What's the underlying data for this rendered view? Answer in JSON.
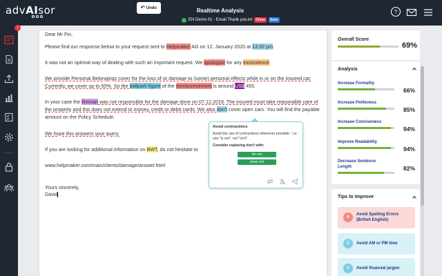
{
  "app": {
    "logo_light": "adv",
    "logo_bold": "AI",
    "logo_end": "sor",
    "title": "Realtime Analysis",
    "undo_label": "Undo",
    "doc_name": "EN Demo 01 - Email Thank you.txt",
    "close_tag": "Close",
    "save_tag": "Save",
    "sidebar_badge": "‹"
  },
  "document": {
    "greeting": "Dear Mr Fin,",
    "p1": {
      "a": "Please find our response below to your request sent to ",
      "b": "Helpmaker",
      "c": " AG on 12. January 2020 at ",
      "d": "13:32 pm",
      "e": "."
    },
    "p2": {
      "a": "It was not an optimal way of dealing with such an important request. We ",
      "b": "apologize",
      "c": " for any ",
      "d": "inconvience"
    },
    "p3": {
      "a": "We provide Personal Belongings cover for the loss of or damage to (some) personal effects while in or on the insured car. Currently, we cover up to 50%. So the ",
      "b": "ballpark figure",
      "c": " of the ",
      "d": "reimburesement",
      "e": " is around ",
      "f": "US$",
      "g": " 455."
    },
    "p4": {
      "a": "In your case the ",
      "b": "fireman",
      "c": " was not responsible for the damage done on 07.12.2019. The insured must take reasonable care of the property and this does not extend to money, credit or debit cards. We also ",
      "d": "don't",
      "e": " cover open cars. You will find the payable amount on the Policy Schedule."
    },
    "p5": "We hope this answers your query.",
    "p6": {
      "a": "If you are looking for additional information on ",
      "b": "BWT",
      "c": ", do not hesitate to"
    },
    "link": "www.helpmaker.com/main/clients/damage/answer.html",
    "closing": "Yours sincerely,",
    "signature": "David"
  },
  "popup": {
    "title": "Avoid contractions",
    "description": "Avoid the use of contractions whenever possible - i.e: use \"is not\", not \"isn't\".",
    "consider": "Consider replacing don't with:",
    "options": [
      "do not",
      "does not"
    ],
    "icons": [
      "hide-icon",
      "ignore-icon",
      "send-icon"
    ]
  },
  "score": {
    "label": "Overall Score",
    "value": "69%",
    "fraction": 0.69
  },
  "analysis": {
    "title": "Analysis",
    "metrics": [
      {
        "label": "Increase Formality",
        "value": "66%",
        "fraction": 0.66
      },
      {
        "label": "Increase Politeness",
        "value": "85%",
        "fraction": 0.85
      },
      {
        "label": "Increase Conciseness",
        "value": "94%",
        "fraction": 0.94
      },
      {
        "label": "Improve Readability",
        "value": "94%",
        "fraction": 0.94
      },
      {
        "label": "Decrease Sentence Length",
        "value": "82%",
        "fraction": 0.82
      }
    ]
  },
  "tips": {
    "title": "Tips to Improve",
    "items": [
      {
        "count": "4",
        "label": "Avoid Spelling Errors (British English)",
        "bg": "#fbd9d6",
        "circle": "#f08a84"
      },
      {
        "count": "1",
        "label": "Avoid AM or PM time",
        "bg": "#d7f1f6",
        "circle": "#7ccfe2"
      },
      {
        "count": "1",
        "label": "Avoid financial jargon",
        "bg": "#d7f1f6",
        "circle": "#7ccfe2"
      }
    ]
  },
  "colors": {
    "dark": "#1f2733",
    "accent_red": "#e0383e",
    "bar_green": "#6fb23a",
    "popup_border": "#8fd0df"
  }
}
